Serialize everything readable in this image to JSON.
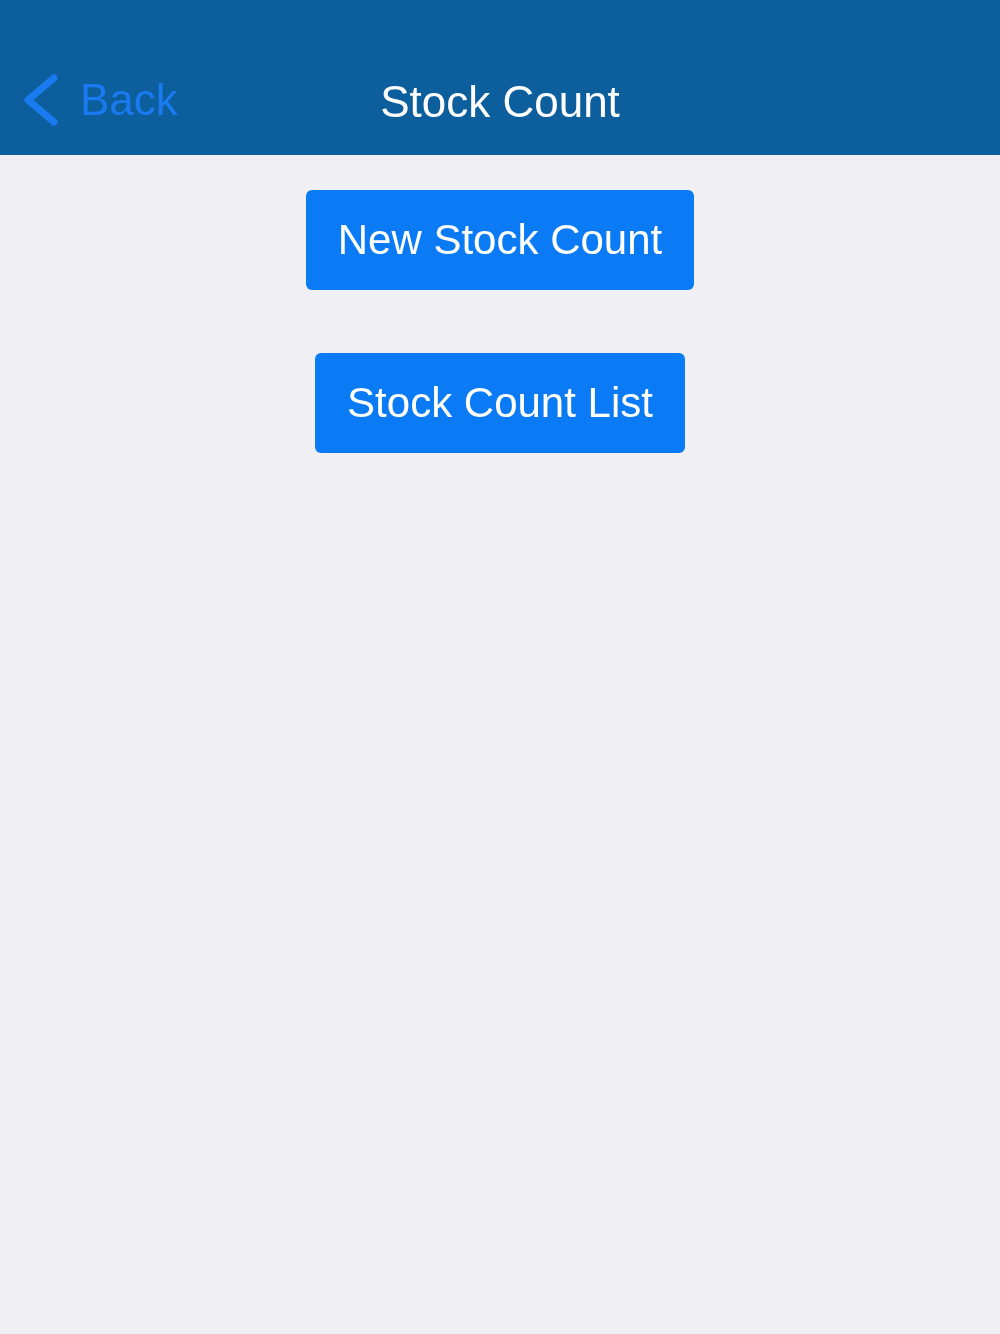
{
  "nav_bar": {
    "back_label": "Back",
    "title": "Stock Count"
  },
  "buttons": [
    {
      "label": "New Stock Count"
    },
    {
      "label": "Stock Count List"
    }
  ]
}
